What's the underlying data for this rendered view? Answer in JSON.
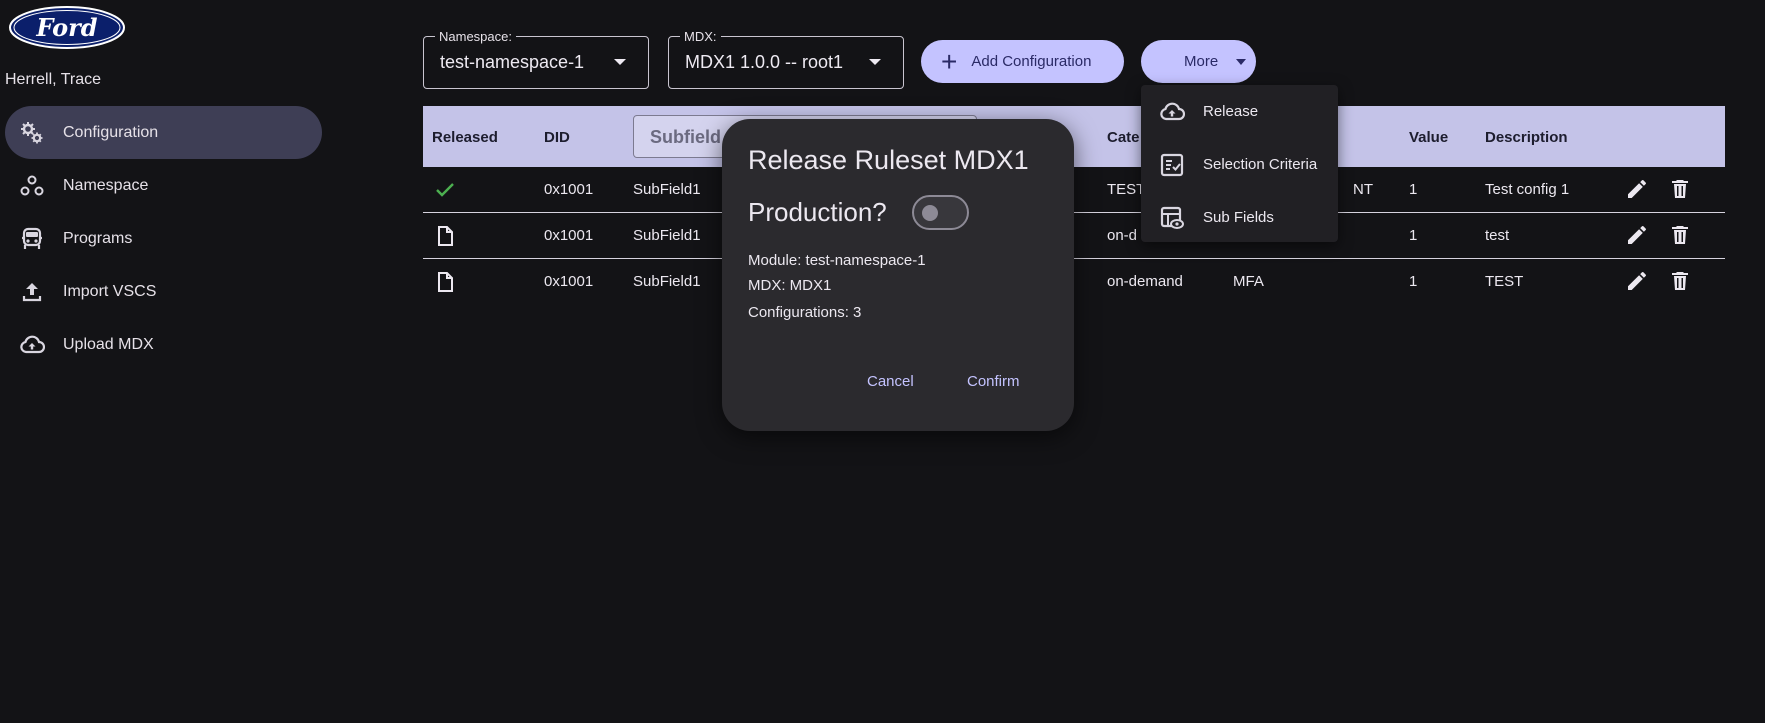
{
  "brand": {
    "logo_text": "Ford"
  },
  "user": {
    "name": "Herrell, Trace"
  },
  "sidebar": {
    "items": [
      {
        "label": "Configuration",
        "icon": "gears-icon",
        "active": true
      },
      {
        "label": "Namespace",
        "icon": "bubbles-icon",
        "active": false
      },
      {
        "label": "Programs",
        "icon": "car-icon",
        "active": false
      },
      {
        "label": "Import VSCS",
        "icon": "upload-icon",
        "active": false
      },
      {
        "label": "Upload MDX",
        "icon": "cloud-upload-icon",
        "active": false
      }
    ]
  },
  "toolbar": {
    "namespace": {
      "label": "Namespace:",
      "value": "test-namespace-1"
    },
    "mdx": {
      "label": "MDX:",
      "value": "MDX1 1.0.0 -- root1"
    },
    "add_label": "Add Configuration",
    "more_label": "More"
  },
  "table": {
    "headers": {
      "released": "Released",
      "did": "DID",
      "subfield_placeholder": "Subfield",
      "category": "Cate",
      "value": "Value",
      "description": "Description"
    },
    "rows": [
      {
        "released": "check-icon",
        "did": "0x1001",
        "subfield": "SubField1",
        "category": "TEST",
        "col5": "NT",
        "value": "1",
        "description": "Test config 1"
      },
      {
        "released": "file-icon",
        "did": "0x1001",
        "subfield": "SubField1",
        "category": "on-d",
        "col5": "",
        "value": "1",
        "description": "test"
      },
      {
        "released": "file-icon",
        "did": "0x1001",
        "subfield": "SubField1",
        "category": "on-demand",
        "col5": "MFA",
        "value": "1",
        "description": "TEST"
      }
    ]
  },
  "dialog": {
    "title": "Release Ruleset MDX1",
    "production_label": "Production?",
    "production_on": false,
    "module": "Module: test-namespace-1",
    "mdx": "MDX: MDX1",
    "configurations": "Configurations: 3",
    "cancel": "Cancel",
    "confirm": "Confirm"
  },
  "more_menu": {
    "items": [
      {
        "label": "Release",
        "icon": "cloud-upload-icon"
      },
      {
        "label": "Selection Criteria",
        "icon": "checklist-icon"
      },
      {
        "label": "Sub Fields",
        "icon": "table-eye-icon"
      }
    ]
  },
  "colors": {
    "background": "#131316",
    "accent": "#c4c3ff",
    "header_bg": "#c4c3e8",
    "active_nav": "#3e3e55",
    "check": "#4caf50"
  }
}
